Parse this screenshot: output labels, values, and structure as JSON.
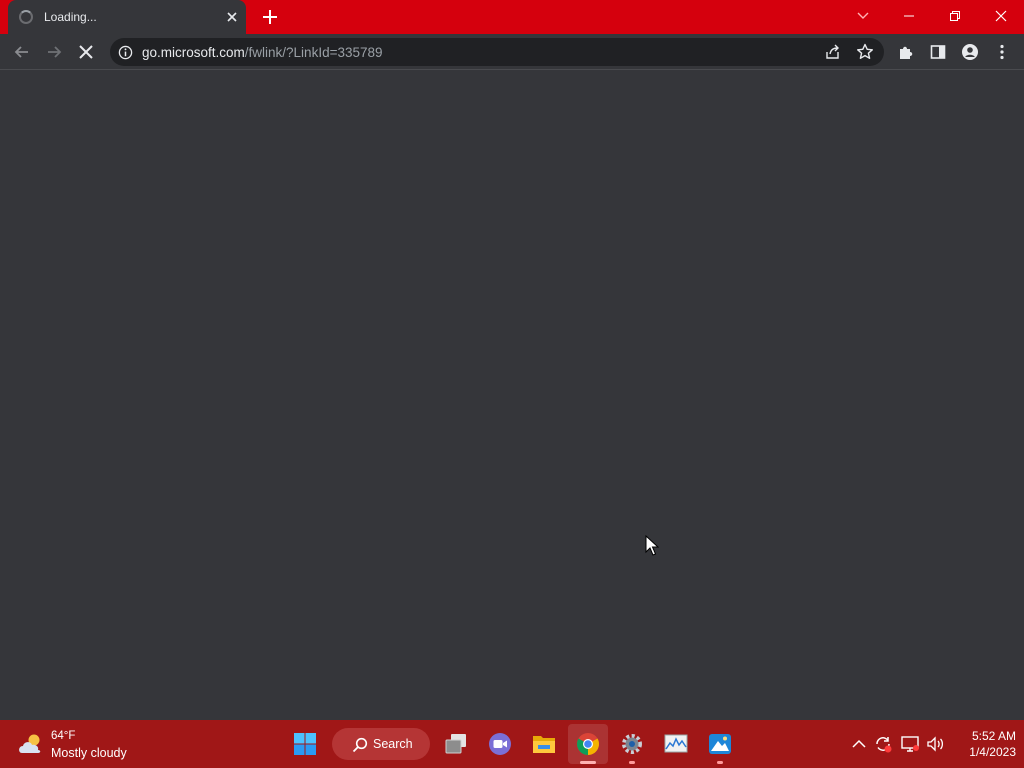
{
  "browser": {
    "tab": {
      "title": "Loading..."
    },
    "address": {
      "host": "go.microsoft.com",
      "path": "/fwlink/?LinkId=335789"
    }
  },
  "taskbar": {
    "weather": {
      "temp": "64°F",
      "condition": "Mostly cloudy"
    },
    "search_label": "Search",
    "clock": {
      "time": "5:52 AM",
      "date": "1/4/2023"
    }
  },
  "colors": {
    "tabstrip": "#d5000d",
    "taskbar": "#a01717",
    "page_background": "#35363a",
    "omnibox": "#202124"
  },
  "icons": [
    "loading-spinner-icon",
    "close-icon",
    "plus-icon",
    "chevron-down-icon",
    "minimize-icon",
    "restore-icon",
    "back-arrow-icon",
    "forward-arrow-icon",
    "stop-icon",
    "info-icon",
    "share-icon",
    "star-icon",
    "puzzle-icon",
    "side-panel-icon",
    "profile-icon",
    "kebab-menu-icon",
    "weather-cloud-sun-icon",
    "windows-start-icon",
    "search-icon",
    "task-view-icon",
    "video-chat-icon",
    "file-explorer-icon",
    "chrome-icon",
    "settings-gear-icon",
    "resource-monitor-icon",
    "photos-icon",
    "chevron-up-icon",
    "sync-icon",
    "network-icon",
    "volume-icon"
  ]
}
